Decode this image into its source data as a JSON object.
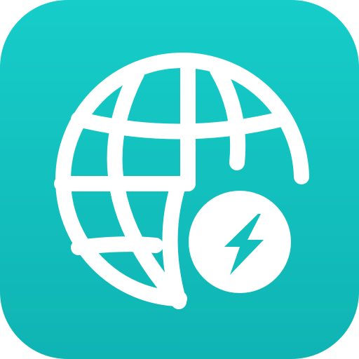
{
  "icon": {
    "name": "globe-with-lightning-app-icon",
    "glyphs": [
      "globe-icon",
      "lightning-bolt-icon"
    ]
  },
  "colors": {
    "background_top": "#16CDC9",
    "background_bottom": "#0FB4B3",
    "glyph": "#FFFFFF",
    "bolt": "#12BFBD"
  }
}
